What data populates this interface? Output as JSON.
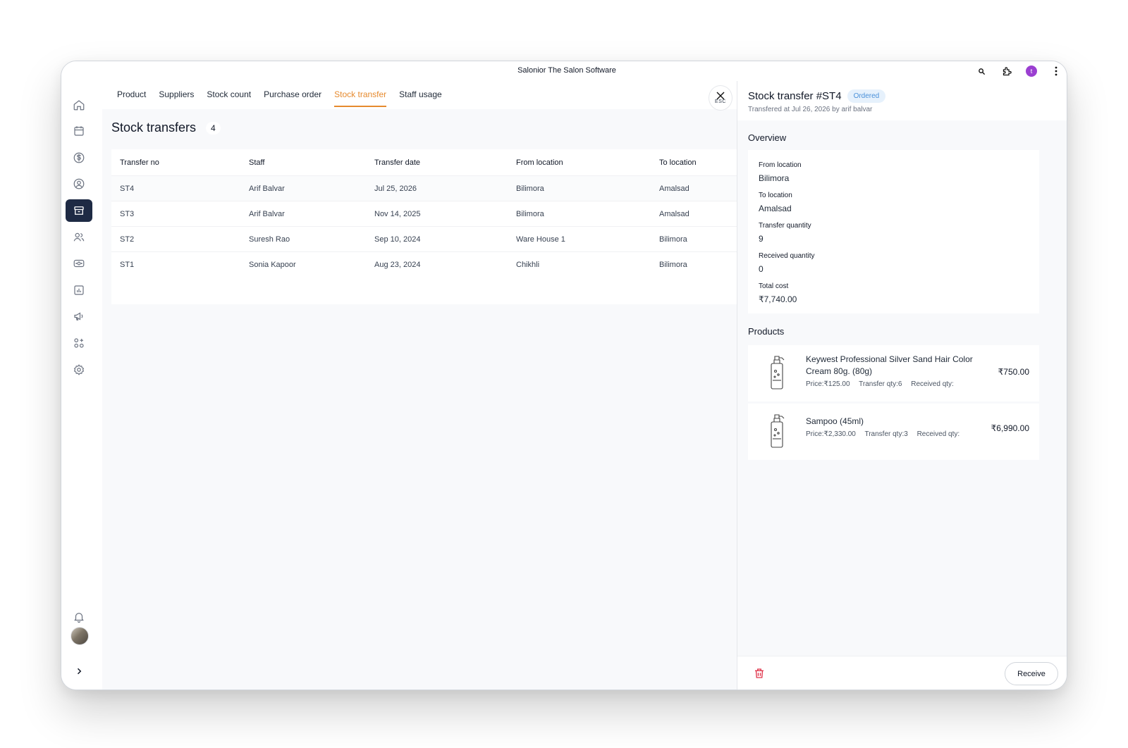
{
  "app": {
    "title": "Salonior The Salon Software",
    "user_initial": "t"
  },
  "tabs": [
    {
      "label": "Product"
    },
    {
      "label": "Suppliers"
    },
    {
      "label": "Stock count"
    },
    {
      "label": "Purchase order"
    },
    {
      "label": "Stock transfer",
      "active": true
    },
    {
      "label": "Staff usage"
    }
  ],
  "close_button": {
    "label": "ESC"
  },
  "list": {
    "title": "Stock transfers",
    "count": "4",
    "columns": [
      "Transfer no",
      "Staff",
      "Transfer date",
      "From location",
      "To location"
    ],
    "rows": [
      [
        "ST4",
        "Arif Balvar",
        "Jul 25, 2026",
        "Bilimora",
        "Amalsad"
      ],
      [
        "ST3",
        "Arif Balvar",
        "Nov 14, 2025",
        "Bilimora",
        "Amalsad"
      ],
      [
        "ST2",
        "Suresh Rao",
        "Sep 10, 2024",
        "Ware House 1",
        "Bilimora"
      ],
      [
        "ST1",
        "Sonia Kapoor",
        "Aug 23, 2024",
        "Chikhli",
        "Bilimora"
      ]
    ]
  },
  "detail": {
    "title": "Stock transfer #ST4",
    "status": "Ordered",
    "subtitle": "Transfered at Jul 26, 2026 by arif balvar",
    "overview_title": "Overview",
    "overview": [
      {
        "label": "From location",
        "value": "Bilimora"
      },
      {
        "label": "To location",
        "value": "Amalsad"
      },
      {
        "label": "Transfer quantity",
        "value": "9"
      },
      {
        "label": "Received quantity",
        "value": "0"
      },
      {
        "label": "Total cost",
        "value": "₹7,740.00"
      }
    ],
    "products_title": "Products",
    "products": [
      {
        "name": "Keywest Professional Silver Sand Hair Color Cream 80g. (80g)",
        "price": "Price:₹125.00",
        "transfer_qty": "Transfer qty:6",
        "received_qty": "Received qty:",
        "total": "₹750.00"
      },
      {
        "name": "Sampoo (45ml)",
        "price": "Price:₹2,330.00",
        "transfer_qty": "Transfer qty:3",
        "received_qty": "Received qty:",
        "total": "₹6,990.00"
      }
    ],
    "receive_label": "Receive"
  },
  "colors": {
    "accent": "#e68a2e",
    "sidebar_active": "#1e2a44",
    "badge_text": "#4a90d9",
    "badge_bg": "#e6f1fc",
    "danger": "#e0344b",
    "avatar": "#9b3fd1"
  },
  "icons": {
    "sidebar": [
      "home-icon",
      "calendar-icon",
      "dollar-icon",
      "user-circle-icon",
      "inventory-box-icon",
      "clients-icon",
      "payments-icon",
      "reports-icon",
      "megaphone-icon",
      "apps-icon",
      "settings-icon"
    ],
    "sidebar_bottom": [
      "bell-icon",
      "avatar",
      "chevron-right-icon"
    ],
    "titlebar": [
      "search-icon",
      "extension-icon",
      "avatar",
      "more-vertical-icon"
    ]
  }
}
